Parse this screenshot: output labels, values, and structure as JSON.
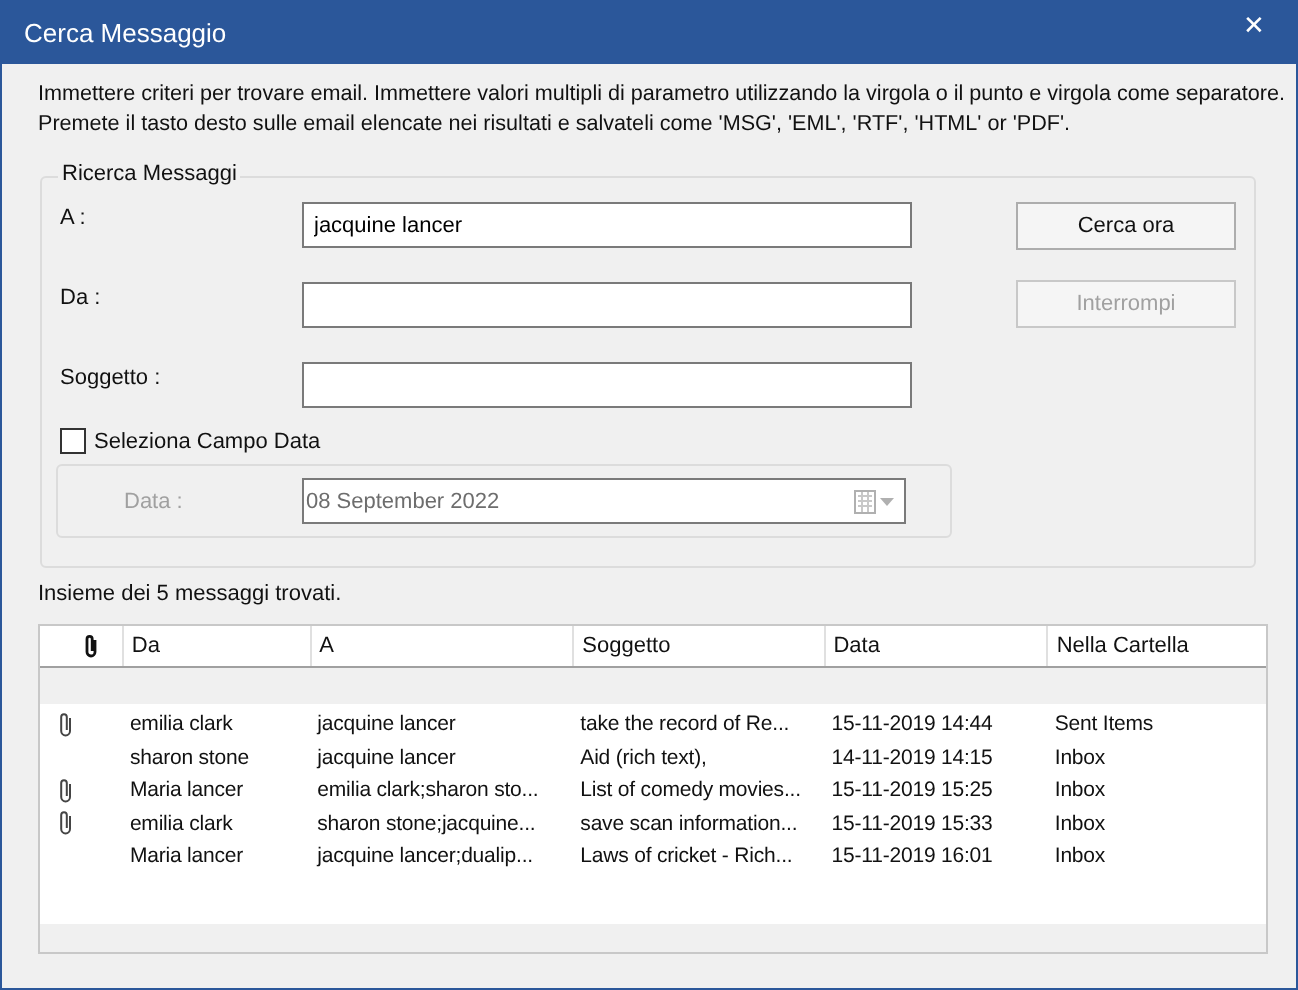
{
  "window": {
    "title": "Cerca Messaggio",
    "close": "✕"
  },
  "intro": [
    "Immettere criteri per trovare email. Immettere valori multipli di parametro utilizzando la virgola o il punto e virgola come separatore.",
    "Premete il tasto desto sulle email elencate nei risultati e salvateli come  'MSG', 'EML', 'RTF', 'HTML' or 'PDF'."
  ],
  "search_group": {
    "title": "Ricerca Messaggi",
    "fields": [
      {
        "label": "A :",
        "value": "jacquine lancer"
      },
      {
        "label": "Da :"
      },
      {
        "label": "Soggetto :"
      }
    ],
    "buttons": [
      {
        "label": "Cerca ora",
        "disabled": false
      },
      {
        "label": "Interrompi",
        "disabled": true
      }
    ],
    "date_checkbox": {
      "label": "Seleziona Campo Data",
      "checked": false
    },
    "date": {
      "label": "Data :",
      "value": "08 September 2022",
      "disabled": true
    }
  },
  "status": "Insieme dei 5 messaggi trovati.",
  "table": {
    "columns": [
      "Da",
      "A",
      "Soggetto",
      "Data",
      "Nella Cartella"
    ],
    "rows": [
      {
        "attachment": true,
        "cells": [
          "emilia clark",
          "jacquine lancer",
          "take the record of Re...",
          "15-11-2019 14:44",
          "Sent Items"
        ]
      },
      {
        "attachment": false,
        "cells": [
          "sharon stone",
          "jacquine lancer",
          "Aid (rich text),",
          "14-11-2019 14:15",
          "Inbox"
        ]
      },
      {
        "attachment": true,
        "cells": [
          "Maria lancer",
          "emilia clark;sharon sto...",
          "List of comedy movies...",
          "15-11-2019 15:25",
          "Inbox"
        ]
      },
      {
        "attachment": true,
        "cells": [
          "emilia clark",
          "sharon stone;jacquine...",
          "save scan information...",
          "15-11-2019 15:33",
          "Inbox"
        ]
      },
      {
        "attachment": false,
        "cells": [
          "Maria lancer",
          "jacquine lancer;dualip...",
          "Laws of cricket - Rich...",
          "15-11-2019 16:01",
          "Inbox"
        ]
      }
    ]
  }
}
